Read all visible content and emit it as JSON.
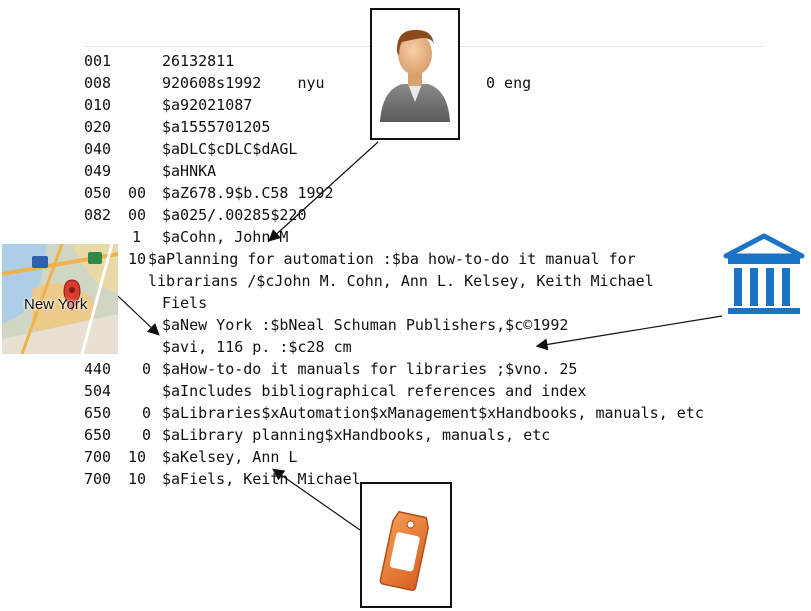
{
  "record": [
    {
      "tag": "001",
      "ind": "",
      "value": "26132811"
    },
    {
      "tag": "008",
      "ind": "",
      "value": "920608s1992    nyu",
      "tail": "0 eng"
    },
    {
      "tag": "010",
      "ind": "",
      "value": "$a92021087"
    },
    {
      "tag": "020",
      "ind": "",
      "value": "$a1555701205"
    },
    {
      "tag": "040",
      "ind": "",
      "value": "$aDLC$cDLC$dAGL"
    },
    {
      "tag": "049",
      "ind": "",
      "value": "$aHNKA"
    },
    {
      "tag": "050",
      "ind": "00",
      "value": "$aZ678.9$b.C58 1992"
    },
    {
      "tag": "082",
      "ind": "00",
      "value": "$a025/.00285$220"
    },
    {
      "tag": "",
      "ind": "1",
      "value": "$aCohn, John M"
    },
    {
      "tag": "",
      "ind": "10",
      "value": "$aPlanning for automation :$ba how-to-do it manual for"
    },
    {
      "tag": "",
      "ind": "",
      "value": "librarians /$cJohn M. Cohn, Ann L. Kelsey, Keith Michael"
    },
    {
      "tag": "",
      "ind": "",
      "value": "Fiels"
    },
    {
      "tag": "260",
      "ind": "",
      "value": "$aNew York :$bNeal Schuman Publishers,$c©1992"
    },
    {
      "tag": "300",
      "ind": "",
      "value": "$avi, 116 p. :$c28 cm"
    },
    {
      "tag": "440",
      "ind": "0",
      "value": "$aHow-to-do it manuals for libraries ;$vno. 25"
    },
    {
      "tag": "504",
      "ind": "",
      "value": "$aIncludes bibliographical references and index"
    },
    {
      "tag": "650",
      "ind": "0",
      "value": "$aLibraries$xAutomation$xManagement$xHandbooks, manuals, etc"
    },
    {
      "tag": "650",
      "ind": "0",
      "value": "$aLibrary planning$xHandbooks, manuals, etc"
    },
    {
      "tag": "700",
      "ind": "10",
      "value": "$aKelsey, Ann L"
    },
    {
      "tag": "700",
      "ind": "10",
      "value": "$aFiels, Keith Michael"
    }
  ],
  "map_label": "New York",
  "icons": {
    "person": "person-icon",
    "map": "map-icon",
    "institution": "institution-icon",
    "tag": "tag-icon"
  },
  "colors": {
    "institution": "#1a73c4",
    "tag": "#e8752e",
    "person_shirt": "#6f6f6f",
    "map_pin": "#d93a30"
  }
}
